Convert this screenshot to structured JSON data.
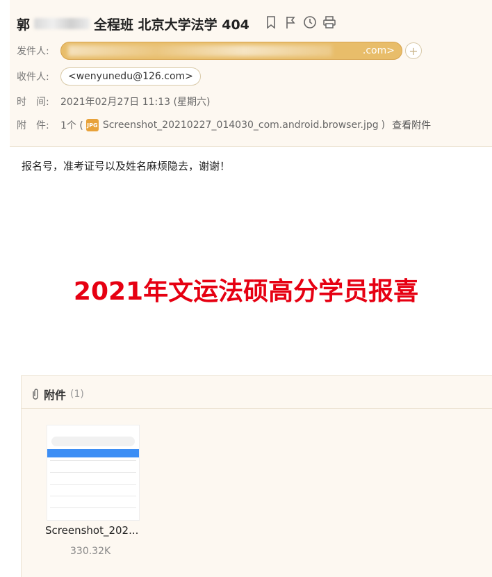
{
  "subject": {
    "prefix": "郭",
    "suffix": "全程班 北京大学法学 404"
  },
  "toolbar": {
    "icons": [
      "bookmark-icon",
      "flag-icon",
      "clock-icon",
      "print-icon"
    ]
  },
  "from": {
    "label": "发件人:",
    "value_tail": ".com>"
  },
  "to": {
    "label": "收件人:",
    "value": "<wenyunedu@126.com>"
  },
  "time": {
    "label": "时　间:",
    "value": "2021年02月27日 11:13 (星期六)"
  },
  "attachment_row": {
    "label": "附　件:",
    "count": "1个 (",
    "file": "Screenshot_20210227_014030_com.android.browser.jpg",
    "close": ")",
    "view": "查看附件"
  },
  "body": {
    "message": "报名号，准考证号以及姓名麻烦隐去，谢谢！"
  },
  "headline": {
    "text": "2021年文运法硕高分学员报喜"
  },
  "attachments": {
    "title": "附件",
    "count": "(1)",
    "file_name": "Screenshot_202...",
    "file_size": "330.32K"
  },
  "colors": {
    "header_bg": "#fdf8f1",
    "headline": "#e60012",
    "from_pill": "#e8bd6a"
  }
}
